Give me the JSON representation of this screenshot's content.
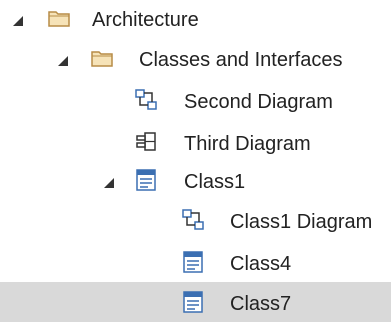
{
  "tree": {
    "items": [
      {
        "label": "Architecture",
        "icon": "folder-icon",
        "expanded": true
      },
      {
        "label": "Classes and Interfaces",
        "icon": "folder-icon",
        "expanded": true
      },
      {
        "label": "Second Diagram",
        "icon": "class-diagram-icon"
      },
      {
        "label": "Third Diagram",
        "icon": "component-diagram-icon"
      },
      {
        "label": "Class1",
        "icon": "class-element-icon",
        "expanded": true
      },
      {
        "label": "Class1 Diagram",
        "icon": "class-diagram-icon"
      },
      {
        "label": "Class4",
        "icon": "class-element-icon"
      },
      {
        "label": "Class7",
        "icon": "class-element-icon",
        "selected": true
      }
    ]
  },
  "colors": {
    "selection": "#d9d9d9",
    "folder_fill": "#f6e3b8",
    "folder_stroke": "#b78c47",
    "diagram_blue": "#3b6fb2",
    "toggle_triangle": "#333333",
    "text": "#222222"
  }
}
